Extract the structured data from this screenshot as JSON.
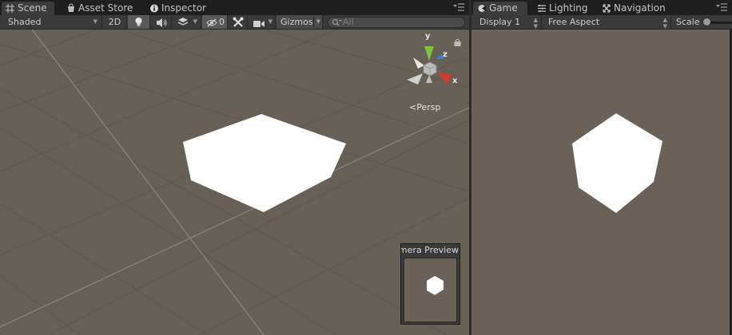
{
  "scene_pane": {
    "tabs": [
      {
        "label": "Scene",
        "icon": "scene-grid-icon",
        "active": true
      },
      {
        "label": "Asset Store",
        "icon": "shopping-bag-icon",
        "active": false
      },
      {
        "label": "Inspector",
        "icon": "info-icon",
        "active": false
      }
    ],
    "toolbar": {
      "draw_mode": "Shaded",
      "mode_2d": "2D",
      "hidden_count": "0",
      "gizmos": "Gizmos",
      "search_placeholder": "All"
    },
    "gizmo": {
      "x": "x",
      "y": "y",
      "z": "z",
      "projection": "Persp"
    },
    "camera_preview": {
      "title": "Camera Preview"
    }
  },
  "game_pane": {
    "tabs": [
      {
        "label": "Game",
        "icon": "game-controller-icon",
        "active": true
      },
      {
        "label": "Lighting",
        "icon": "lighting-list-icon",
        "active": false
      },
      {
        "label": "Navigation",
        "icon": "navigation-icon",
        "active": false
      }
    ],
    "toolbar": {
      "display": "Display 1",
      "aspect": "Free Aspect",
      "scale_label": "Scale",
      "scale_value": 0
    }
  },
  "colors": {
    "viewport_bg": "#676057",
    "ui_bg": "#3c3c3c",
    "axis_x": "#d13a2c",
    "axis_y": "#7ac53c",
    "axis_z": "#3a7fd6"
  }
}
